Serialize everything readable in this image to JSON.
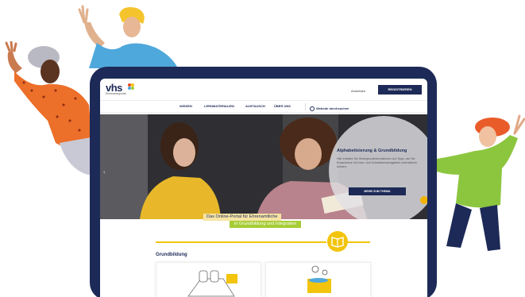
{
  "header": {
    "logo_text": "vhs",
    "logo_sub": "Ehrenamtsportal",
    "login_label": "Anmelden",
    "register_label": "REGISTRIEREN"
  },
  "nav": {
    "items": [
      "WISSEN",
      "LERNMATERIALIEN",
      "AUSTAUSCH",
      "ÜBER UNS"
    ],
    "search_placeholder": "Website durchsuchen"
  },
  "hero": {
    "title": "Alphabetisierung & Grundbildung",
    "text": "Hier erhalten Sie Hintergrundinformationen und Tipps, wie Sie Erwachsene mit Lese- und Schreibschwierigkeiten unterstützen können.",
    "button": "MEHR ZUM THEMA"
  },
  "tagline": {
    "line1": "Das Online-Portal für Ehrenamtliche",
    "line2": "in Grundbildung und Integration"
  },
  "section": {
    "title": "Grundbildung"
  },
  "colors": {
    "navy": "#1d2a57",
    "yellow": "#f2c40c",
    "green": "#a7cd36"
  }
}
